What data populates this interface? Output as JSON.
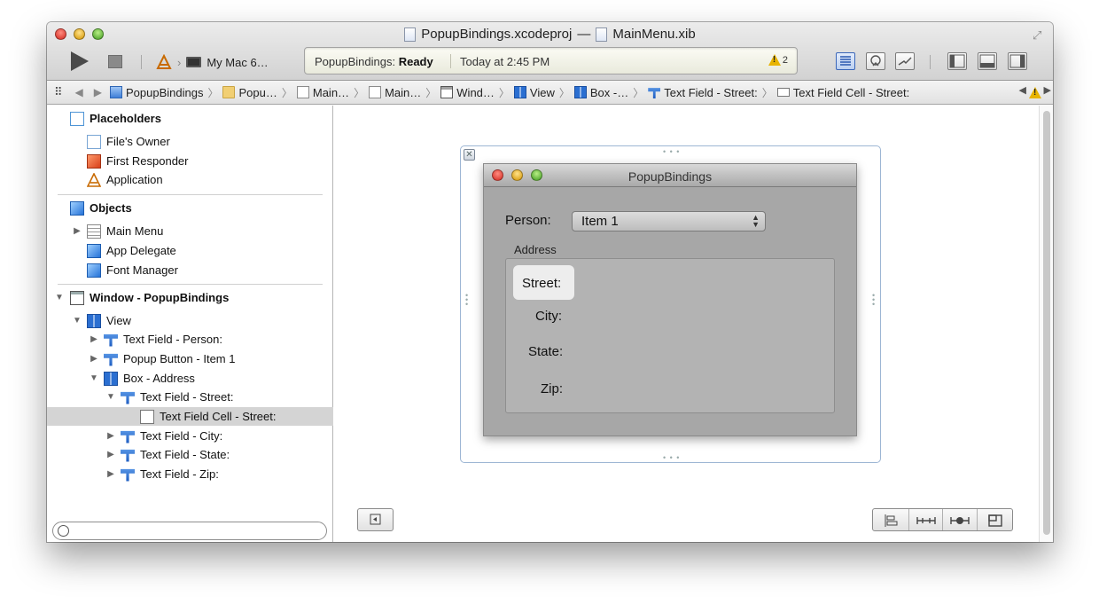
{
  "window": {
    "title_project": "PopupBindings.xcodeproj",
    "title_sep": "—",
    "title_file": "MainMenu.xib"
  },
  "toolbar": {
    "scheme": "My Mac 6…",
    "status_app": "PopupBindings:",
    "status_state": "Ready",
    "status_time": "Today at 2:45 PM",
    "warnings": "2"
  },
  "jumpbar": {
    "items": [
      "PopupBindings",
      "Popu…",
      "Main…",
      "Main…",
      "Wind…",
      "View",
      "Box -…",
      "Text Field - Street:",
      "Text Field Cell - Street:"
    ]
  },
  "navigator": {
    "placeholders_header": "Placeholders",
    "files_owner": "File's Owner",
    "first_responder": "First Responder",
    "application": "Application",
    "objects_header": "Objects",
    "main_menu": "Main Menu",
    "app_delegate": "App Delegate",
    "font_manager": "Font Manager",
    "window": "Window - PopupBindings",
    "view": "View",
    "tf_person": "Text Field - Person:",
    "popup_button": "Popup Button - Item 1",
    "box_address": "Box - Address",
    "tf_street": "Text Field - Street:",
    "tf_cell_street": "Text Field Cell - Street:",
    "tf_city": "Text Field - City:",
    "tf_state": "Text Field - State:",
    "tf_zip": "Text Field - Zip:"
  },
  "canvas": {
    "window_title": "PopupBindings",
    "person_label": "Person:",
    "popup_value": "Item 1",
    "box_title": "Address",
    "street_label": "Street:",
    "city_label": "City:",
    "state_label": "State:",
    "zip_label": "Zip:"
  }
}
